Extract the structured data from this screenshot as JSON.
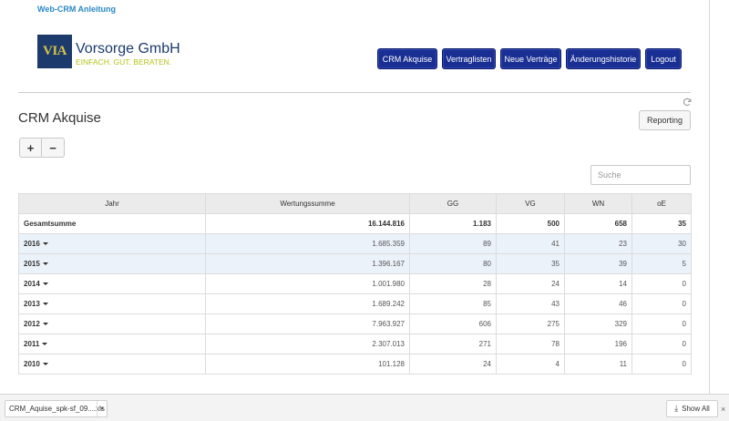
{
  "header": {
    "top_link": "Web-CRM Anleitung",
    "logo": {
      "mark": "VIA",
      "name": "Vorsorge GmbH",
      "slogan": "EINFACH. GUT. BERATEN."
    }
  },
  "nav": {
    "items": [
      {
        "label": "CRM Akquise"
      },
      {
        "label": "Vertraglisten"
      },
      {
        "label": "Neue Verträge"
      },
      {
        "label": "Änderungshistorie"
      },
      {
        "label": "Logout"
      }
    ]
  },
  "main": {
    "title": "CRM Akquise",
    "reporting_label": "Reporting",
    "expand_label": "+",
    "collapse_label": "−",
    "search_placeholder": "Suche",
    "refresh_icon": "refresh-icon"
  },
  "table": {
    "columns": [
      "Jahr",
      "Wertungssumme",
      "GG",
      "VG",
      "WN",
      "oE"
    ],
    "total": {
      "label": "Gesamtsumme",
      "values": [
        "16.144.816",
        "1.183",
        "500",
        "658",
        "35"
      ]
    },
    "rows": [
      {
        "year": "2016",
        "values": [
          "1.685.359",
          "89",
          "41",
          "23",
          "30"
        ]
      },
      {
        "year": "2015",
        "values": [
          "1.396.167",
          "80",
          "35",
          "39",
          "5"
        ]
      },
      {
        "year": "2014",
        "values": [
          "1.001.980",
          "28",
          "24",
          "14",
          "0"
        ]
      },
      {
        "year": "2013",
        "values": [
          "1.689.242",
          "85",
          "43",
          "46",
          "0"
        ]
      },
      {
        "year": "2012",
        "values": [
          "7.963.927",
          "606",
          "275",
          "329",
          "0"
        ]
      },
      {
        "year": "2011",
        "values": [
          "2.307.013",
          "271",
          "78",
          "196",
          "0"
        ]
      },
      {
        "year": "2010",
        "values": [
          "101.128",
          "24",
          "4",
          "11",
          "0"
        ]
      }
    ]
  },
  "downloads": {
    "file_name": "CRM_Aquise_spk-sf_09....xls",
    "show_all_label": "Show All",
    "close_label": "×"
  },
  "colors": {
    "nav_bg": "#1a2f93",
    "link": "#2a88c5",
    "logo_blue": "#1c3a6b",
    "logo_green": "#b5c21a",
    "row_highlight": "#ecf2fa"
  }
}
